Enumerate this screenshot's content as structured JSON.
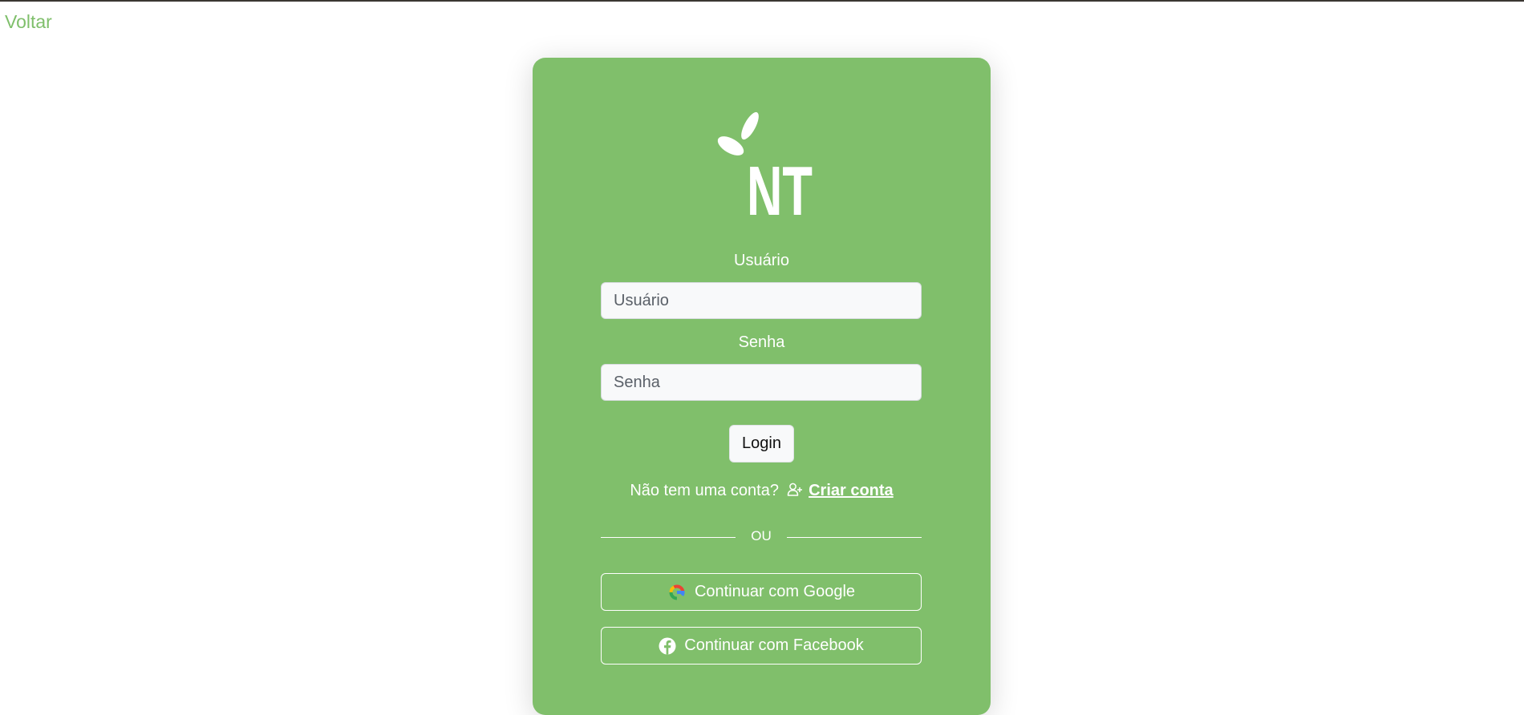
{
  "nav": {
    "back_label": "Voltar"
  },
  "logo": {
    "text": "NT",
    "icon": "leaves-icon"
  },
  "form": {
    "username": {
      "label": "Usuário",
      "placeholder": "Usuário",
      "value": ""
    },
    "password": {
      "label": "Senha",
      "placeholder": "Senha",
      "value": ""
    },
    "login_label": "Login"
  },
  "signup": {
    "prompt": "Não tem uma conta?",
    "icon": "user-plus-icon",
    "link_label": "Criar conta"
  },
  "divider": {
    "text": "OU"
  },
  "social": {
    "google_label": "Continuar com Google",
    "google_icon": "google-icon",
    "facebook_label": "Continuar com Facebook",
    "facebook_icon": "facebook-icon"
  },
  "colors": {
    "brand_green": "#80bf6b",
    "link_green": "#7fbf6b",
    "white": "#ffffff"
  }
}
